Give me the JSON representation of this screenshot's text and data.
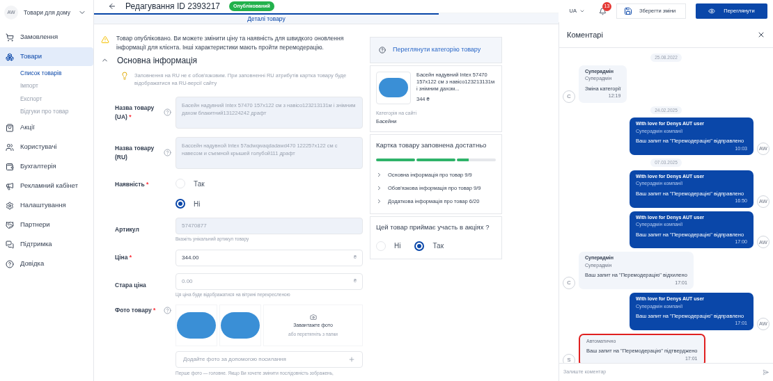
{
  "store": {
    "avatar": "AW",
    "name": "Товари для дому"
  },
  "sidebar": {
    "items": [
      {
        "label": "Замовлення",
        "selected": false
      },
      {
        "label": "Товари",
        "selected": true,
        "children": [
          {
            "label": "Список товарів",
            "selected": true
          },
          {
            "label": "Імпорт",
            "selected": false
          },
          {
            "label": "Експорт",
            "selected": false
          },
          {
            "label": "Відгуки про товар",
            "selected": false
          }
        ]
      },
      {
        "label": "Акції",
        "selected": false
      },
      {
        "label": "Користувачі",
        "selected": false
      },
      {
        "label": "Бухгалтерія",
        "selected": false
      },
      {
        "label": "Рекламний кабінет",
        "selected": false
      },
      {
        "label": "Налаштування",
        "selected": false
      },
      {
        "label": "Партнери",
        "selected": false
      },
      {
        "label": "Підтримка",
        "selected": false
      },
      {
        "label": "Довідка",
        "selected": false
      }
    ]
  },
  "header": {
    "title": "Редагування ID 2393217",
    "status": "Опублікований",
    "language": "UA",
    "notifications": "13",
    "save_button": "Зберегти зміни",
    "view_button": "Переглянути"
  },
  "tabs": [
    {
      "label": "Деталі товару",
      "selected": true
    }
  ],
  "notice": "Товар опубліковано. Ви можете змінити ціну та наявність для швидкого оновлення інформації для клієнта. Інші характеристики мають пройти перемодерацію.",
  "section": {
    "title": "Основна інформація",
    "expanded": true,
    "hint": "Заповнення на RU не є обов'язковим. При заповненні RU атрибутів картка товару буде відображатися на RU-версії сайту"
  },
  "fields": [
    {
      "kind": "textarea",
      "label": "Назва товару (UA)",
      "required_mark": "*",
      "help": true,
      "value": "Басейн надувний Intex 57470 157x122 см з навісо123213131м і знімним дахом блакитний131224242 драфт",
      "disabled": true
    },
    {
      "kind": "textarea",
      "label": "Назва товару (RU)",
      "help": true,
      "value": "Бассейн надувной Intex 57adwqwaqdadawd470 122257x122 см с навесом и съемной крышей голубой111 драфт",
      "disabled": true
    },
    {
      "kind": "radio",
      "label": "Наявність",
      "required_mark": "*",
      "help": false,
      "options": [
        {
          "label": "Так",
          "selected": false
        },
        {
          "label": "Ні",
          "selected": true
        }
      ]
    },
    {
      "kind": "input",
      "label": "Артикул",
      "help": false,
      "value": "57470877",
      "disabled": true,
      "note": "Вкажіть унікальний артикул товару"
    },
    {
      "kind": "input",
      "label": "Ціна",
      "required_mark": "*",
      "help": false,
      "value": "344.00",
      "disabled": false,
      "suffix": "₴"
    },
    {
      "kind": "input",
      "label": "Стара ціна",
      "help": false,
      "placeholder": "0.00",
      "disabled": false,
      "suffix": "₴",
      "note": "Ця ціна буде відображатися на вітрині перекресленою"
    },
    {
      "kind": "photos",
      "label": "Фото товару",
      "required_mark": "*",
      "help": true,
      "upload_title": "Завантажте фото",
      "upload_hint": "або перетягніть з папки",
      "url_placeholder": "Додайте фото за допомогою посилання",
      "note": "Перше фото — головне. Якщо Ви хочете змінити послідовність зображень,"
    }
  ],
  "category_link": "Переглянути категорію товару",
  "preview": {
    "name": "Басейн надувний Intex 57470 157x122 см з навісо123213131м і знімним дахом...",
    "price": "344 ₴",
    "category_label": "Категорія на сайті",
    "category": "Басейни"
  },
  "completeness": {
    "title": "Картка товару заповнена достатньо",
    "segments": [
      {
        "level": 1
      },
      {
        "level": 1
      },
      {
        "level": 0.3
      }
    ],
    "items": [
      "Основна інформація про товар 9/9",
      "Обов'язкова інформація про товар 9/9",
      "Додаткова інформація про товар 6/20"
    ]
  },
  "promo": {
    "question": "Цей товар приймає участь в акціях ?",
    "options": [
      {
        "label": "Ні",
        "selected": false
      },
      {
        "label": "Так",
        "selected": true
      }
    ]
  },
  "comments": {
    "title": "Коментарі",
    "input_placeholder": "Залиште коментар",
    "items": [
      {
        "kind": "date",
        "text": "25.08.2022"
      },
      {
        "kind": "incoming",
        "avatar": "C",
        "author": "Суперадмін",
        "role": "Суперадмін",
        "text": "Зміна категорії",
        "time": "12:19",
        "highlighted": false
      },
      {
        "kind": "date",
        "text": "24.02.2025"
      },
      {
        "kind": "outgoing",
        "avatar": "AW",
        "author": "With love for Denys AUT user",
        "role": "Суперадмін компанії",
        "text": "Ваш запит на \"Перемодерацію\" відправлено",
        "time": "10:03",
        "highlighted": false
      },
      {
        "kind": "date",
        "text": "07.03.2025"
      },
      {
        "kind": "outgoing",
        "avatar": "AW",
        "author": "With love for Denys AUT user",
        "role": "Суперадмін компанії",
        "text": "Ваш запит на \"Перемодерацію\" відправлено",
        "time": "16:50",
        "highlighted": false
      },
      {
        "kind": "outgoing",
        "avatar": "AW",
        "author": "With love for Denys AUT user",
        "role": "Суперадмін компанії",
        "text": "Ваш запит на \"Перемодерацію\" відправлено",
        "time": "17:00",
        "highlighted": false
      },
      {
        "kind": "incoming",
        "avatar": "C",
        "author": "Суперадмін",
        "role": "Суперадмін",
        "text": "Ваш запит на \"Перемодерацію\" відхилено",
        "time": "17:01",
        "highlighted": false
      },
      {
        "kind": "outgoing",
        "avatar": "AW",
        "author": "With love for Denys AUT user",
        "role": "Суперадмін компанії",
        "text": "Ваш запит на \"Перемодерацію\" відправлено",
        "time": "17:01",
        "highlighted": false
      },
      {
        "kind": "incoming",
        "avatar": "S",
        "role": "Автоматично",
        "text": "Ваш запит на \"Перемодерацію\" підтверджено",
        "time": "17:01",
        "highlighted": true
      }
    ]
  }
}
